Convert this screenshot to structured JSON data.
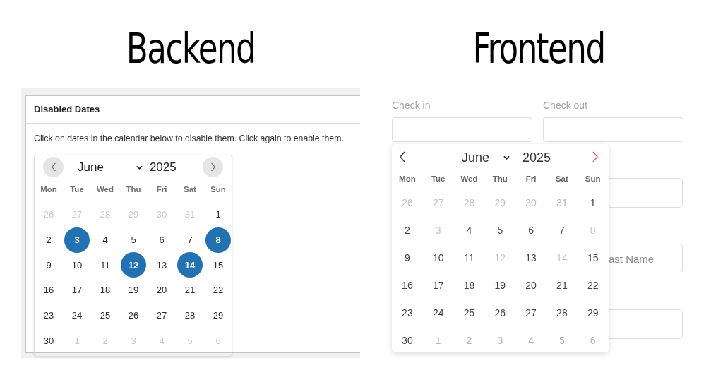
{
  "headings": [
    "Backend",
    "Frontend"
  ],
  "backend": {
    "panel_title": "Disabled Dates",
    "instructions": "Click on dates in the calendar below to disable them. Click again to enable them.",
    "calendar": {
      "month": "June",
      "year": "2025",
      "weekdays": [
        "Mon",
        "Tue",
        "Wed",
        "Thu",
        "Fri",
        "Sat",
        "Sun"
      ],
      "days": [
        {
          "label": "26",
          "outside": true,
          "selected": false
        },
        {
          "label": "27",
          "outside": true,
          "selected": false
        },
        {
          "label": "28",
          "outside": true,
          "selected": false
        },
        {
          "label": "29",
          "outside": true,
          "selected": false
        },
        {
          "label": "30",
          "outside": true,
          "selected": false
        },
        {
          "label": "31",
          "outside": true,
          "selected": false
        },
        {
          "label": "1",
          "outside": false,
          "selected": false
        },
        {
          "label": "2",
          "outside": false,
          "selected": false
        },
        {
          "label": "3",
          "outside": false,
          "selected": true
        },
        {
          "label": "4",
          "outside": false,
          "selected": false
        },
        {
          "label": "5",
          "outside": false,
          "selected": false
        },
        {
          "label": "6",
          "outside": false,
          "selected": false
        },
        {
          "label": "7",
          "outside": false,
          "selected": false
        },
        {
          "label": "8",
          "outside": false,
          "selected": true
        },
        {
          "label": "9",
          "outside": false,
          "selected": false
        },
        {
          "label": "10",
          "outside": false,
          "selected": false
        },
        {
          "label": "11",
          "outside": false,
          "selected": false
        },
        {
          "label": "12",
          "outside": false,
          "selected": true
        },
        {
          "label": "13",
          "outside": false,
          "selected": false
        },
        {
          "label": "14",
          "outside": false,
          "selected": true
        },
        {
          "label": "15",
          "outside": false,
          "selected": false
        },
        {
          "label": "16",
          "outside": false,
          "selected": false
        },
        {
          "label": "17",
          "outside": false,
          "selected": false
        },
        {
          "label": "18",
          "outside": false,
          "selected": false
        },
        {
          "label": "19",
          "outside": false,
          "selected": false
        },
        {
          "label": "20",
          "outside": false,
          "selected": false
        },
        {
          "label": "21",
          "outside": false,
          "selected": false
        },
        {
          "label": "22",
          "outside": false,
          "selected": false
        },
        {
          "label": "23",
          "outside": false,
          "selected": false
        },
        {
          "label": "24",
          "outside": false,
          "selected": false
        },
        {
          "label": "25",
          "outside": false,
          "selected": false
        },
        {
          "label": "26",
          "outside": false,
          "selected": false
        },
        {
          "label": "27",
          "outside": false,
          "selected": false
        },
        {
          "label": "28",
          "outside": false,
          "selected": false
        },
        {
          "label": "29",
          "outside": false,
          "selected": false
        },
        {
          "label": "30",
          "outside": false,
          "selected": false
        },
        {
          "label": "1",
          "outside": true,
          "selected": false
        },
        {
          "label": "2",
          "outside": true,
          "selected": false
        },
        {
          "label": "3",
          "outside": true,
          "selected": false
        },
        {
          "label": "4",
          "outside": true,
          "selected": false
        },
        {
          "label": "5",
          "outside": true,
          "selected": false
        },
        {
          "label": "6",
          "outside": true,
          "selected": false
        }
      ]
    }
  },
  "frontend": {
    "fields": [
      {
        "label": "Check in"
      },
      {
        "label": "Check out"
      }
    ],
    "other_fields": [
      {
        "kind": "blank"
      },
      {
        "kind": "text",
        "placeholder": "ast Name"
      },
      {
        "kind": "blank"
      }
    ],
    "calendar": {
      "month": "June",
      "year": "2025",
      "weekdays": [
        "Mon",
        "Tue",
        "Wed",
        "Thu",
        "Fri",
        "Sat",
        "Sun"
      ],
      "days": [
        {
          "label": "26",
          "outside": true,
          "disabled": true
        },
        {
          "label": "27",
          "outside": true,
          "disabled": true
        },
        {
          "label": "28",
          "outside": true,
          "disabled": true
        },
        {
          "label": "29",
          "outside": true,
          "disabled": true
        },
        {
          "label": "30",
          "outside": true,
          "disabled": true
        },
        {
          "label": "31",
          "outside": true,
          "disabled": false
        },
        {
          "label": "1",
          "outside": false,
          "disabled": false
        },
        {
          "label": "2",
          "outside": false,
          "disabled": false
        },
        {
          "label": "3",
          "outside": false,
          "disabled": true
        },
        {
          "label": "4",
          "outside": false,
          "disabled": false
        },
        {
          "label": "5",
          "outside": false,
          "disabled": false
        },
        {
          "label": "6",
          "outside": false,
          "disabled": false
        },
        {
          "label": "7",
          "outside": false,
          "disabled": false
        },
        {
          "label": "8",
          "outside": false,
          "disabled": true
        },
        {
          "label": "9",
          "outside": false,
          "disabled": false
        },
        {
          "label": "10",
          "outside": false,
          "disabled": false
        },
        {
          "label": "11",
          "outside": false,
          "disabled": false
        },
        {
          "label": "12",
          "outside": false,
          "disabled": true
        },
        {
          "label": "13",
          "outside": false,
          "disabled": false
        },
        {
          "label": "14",
          "outside": false,
          "disabled": true
        },
        {
          "label": "15",
          "outside": false,
          "disabled": false
        },
        {
          "label": "16",
          "outside": false,
          "disabled": false
        },
        {
          "label": "17",
          "outside": false,
          "disabled": false
        },
        {
          "label": "18",
          "outside": false,
          "disabled": false
        },
        {
          "label": "19",
          "outside": false,
          "disabled": false
        },
        {
          "label": "20",
          "outside": false,
          "disabled": false
        },
        {
          "label": "21",
          "outside": false,
          "disabled": false
        },
        {
          "label": "22",
          "outside": false,
          "disabled": false
        },
        {
          "label": "23",
          "outside": false,
          "disabled": false
        },
        {
          "label": "24",
          "outside": false,
          "disabled": false
        },
        {
          "label": "25",
          "outside": false,
          "disabled": false
        },
        {
          "label": "26",
          "outside": false,
          "disabled": false
        },
        {
          "label": "27",
          "outside": false,
          "disabled": false
        },
        {
          "label": "28",
          "outside": false,
          "disabled": false
        },
        {
          "label": "29",
          "outside": false,
          "disabled": false
        },
        {
          "label": "30",
          "outside": false,
          "disabled": false
        },
        {
          "label": "1",
          "outside": true,
          "disabled": false
        },
        {
          "label": "2",
          "outside": true,
          "disabled": false
        },
        {
          "label": "3",
          "outside": true,
          "disabled": false
        },
        {
          "label": "4",
          "outside": true,
          "disabled": false
        },
        {
          "label": "5",
          "outside": true,
          "disabled": false
        },
        {
          "label": "6",
          "outside": true,
          "disabled": false
        }
      ]
    }
  }
}
